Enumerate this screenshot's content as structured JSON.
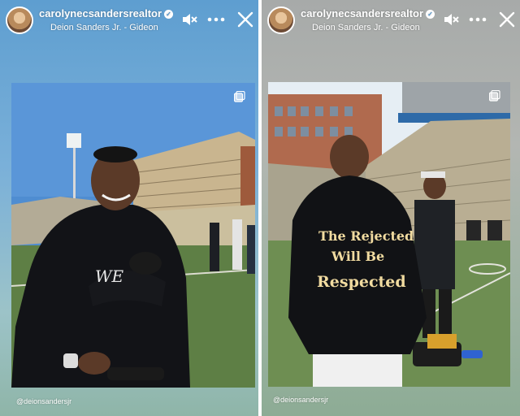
{
  "stories": [
    {
      "username": "carolynecsandersrealtor",
      "song": "Deion Sanders Jr. - Gideon",
      "credit": "@deionsandersjr",
      "chest_text": "WE"
    },
    {
      "username": "carolynecsandersrealtor",
      "song": "Deion Sanders Jr. - Gideon",
      "credit": "@deionsandersjr",
      "hoodie_text": [
        "The Rejected",
        "Will Be",
        "Respected"
      ]
    }
  ],
  "icons": {
    "verified": "verified-badge-icon",
    "mute": "speaker-muted-icon",
    "more": "more-options-icon",
    "close": "close-icon",
    "multi_photo": "multiple-photos-icon"
  },
  "colors": {
    "left_bg": "#6ea8d6",
    "right_bg": "#a9aca9",
    "text": "#ffffff"
  }
}
